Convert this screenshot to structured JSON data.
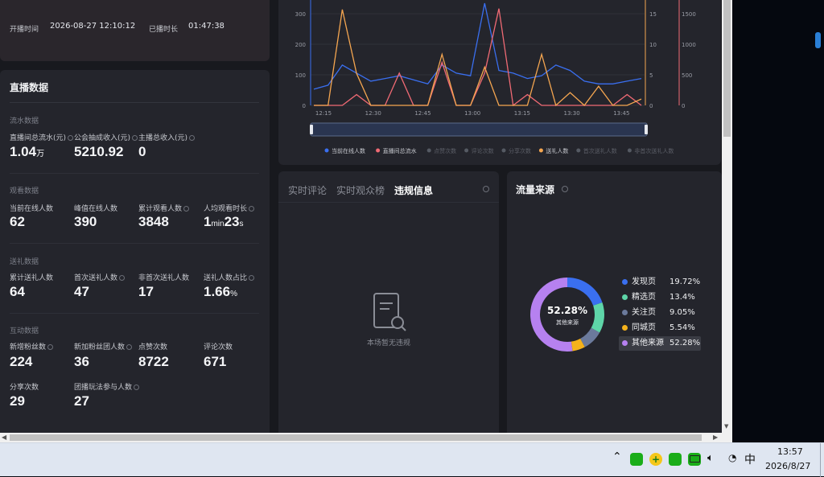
{
  "header": {
    "start_label": "开播时间",
    "start_value": "2026-08-27 12:10:12",
    "duration_label": "已播时长",
    "duration_value": "01:47:38"
  },
  "stats": {
    "title": "直播数据",
    "revenue": {
      "section": "流水数据",
      "items": [
        {
          "label": "直播间总流水(元)",
          "value": "1.04",
          "unit": "万"
        },
        {
          "label": "公会抽成收入(元)",
          "value": "5210.92",
          "unit": ""
        },
        {
          "label": "主播总收入(元)",
          "value": "0",
          "unit": ""
        }
      ]
    },
    "viewers": {
      "section": "观看数据",
      "items": [
        {
          "label": "当前在线人数",
          "value": "62"
        },
        {
          "label": "峰值在线人数",
          "value": "390"
        },
        {
          "label": "累计观看人数",
          "value": "3848"
        },
        {
          "label": "人均观看时长",
          "value_a": "1",
          "unit_a": "min",
          "value_b": "23",
          "unit_b": "s"
        }
      ]
    },
    "gifts": {
      "section": "送礼数据",
      "items": [
        {
          "label": "累计送礼人数",
          "value": "64"
        },
        {
          "label": "首次送礼人数",
          "value": "47"
        },
        {
          "label": "非首次送礼人数",
          "value": "17"
        },
        {
          "label": "送礼人数占比",
          "value": "1.66",
          "unit": "%"
        }
      ]
    },
    "interaction": {
      "section": "互动数据",
      "items": [
        {
          "label": "新增粉丝数",
          "value": "224"
        },
        {
          "label": "新加粉丝团人数",
          "value": "36"
        },
        {
          "label": "点赞次数",
          "value": "8722"
        },
        {
          "label": "评论次数",
          "value": "671"
        },
        {
          "label": "分享次数",
          "value": "29"
        },
        {
          "label": "团播玩法参与人数",
          "value": "27"
        }
      ]
    }
  },
  "chart_data": {
    "type": "line",
    "x": [
      "12:15",
      "12:30",
      "12:45",
      "13:00",
      "13:15",
      "13:30",
      "13:45"
    ],
    "y_left_ticks": [
      "0",
      "100",
      "200",
      "300"
    ],
    "y_mid_ticks": [
      "0",
      "5",
      "10",
      "15"
    ],
    "y_right_ticks": [
      "0",
      "500",
      "1000",
      "1500"
    ],
    "series": [
      {
        "name": "当前在线人数",
        "color": "#3a6ff0",
        "values": [
          60,
          75,
          150,
          120,
          90,
          100,
          110,
          95,
          80,
          150,
          120,
          110,
          380,
          130,
          120,
          100,
          110,
          150,
          130,
          90,
          80,
          80,
          90,
          100
        ]
      },
      {
        "name": "直播间总流水",
        "color": "#f06a74",
        "values": [
          0,
          0,
          0,
          10,
          0,
          0,
          30,
          0,
          0,
          40,
          0,
          0,
          30,
          90,
          0,
          10,
          0,
          0,
          0,
          0,
          0,
          0,
          10,
          0
        ]
      },
      {
        "name": "点赞次数",
        "color": "#555a63",
        "values": []
      },
      {
        "name": "评论次数",
        "color": "#555a63",
        "values": []
      },
      {
        "name": "分享次数",
        "color": "#555a63",
        "values": []
      },
      {
        "name": "送礼人数",
        "color": "#f5a650",
        "values": [
          0,
          0,
          15,
          5,
          0,
          0,
          0,
          0,
          0,
          8,
          0,
          0,
          6,
          0,
          0,
          0,
          8,
          0,
          2,
          0,
          3,
          0,
          0,
          1
        ]
      },
      {
        "name": "首次送礼人数",
        "color": "#555a63",
        "values": []
      },
      {
        "name": "非首次送礼人数",
        "color": "#555a63",
        "values": []
      }
    ]
  },
  "tabs": {
    "items": [
      "实时评论",
      "实时观众榜",
      "违规信息"
    ],
    "active": 2,
    "empty_text": "本场暂无违规"
  },
  "traffic": {
    "title": "流量来源",
    "center_value": "52.28%",
    "center_label": "其他来源",
    "items": [
      {
        "name": "发现页",
        "pct": "19.72%",
        "value": 19.72,
        "color": "#3a6ff0"
      },
      {
        "name": "精选页",
        "pct": "13.4%",
        "value": 13.4,
        "color": "#5ed5a8"
      },
      {
        "name": "关注页",
        "pct": "9.05%",
        "value": 9.05,
        "color": "#6b7a9c"
      },
      {
        "name": "同城页",
        "pct": "5.54%",
        "value": 5.54,
        "color": "#f5b21b"
      },
      {
        "name": "其他来源",
        "pct": "52.28%",
        "value": 52.28,
        "color": "#b681f0"
      }
    ]
  },
  "taskbar": {
    "time": "13:57",
    "date": "2026/8/27",
    "ime": "中"
  }
}
